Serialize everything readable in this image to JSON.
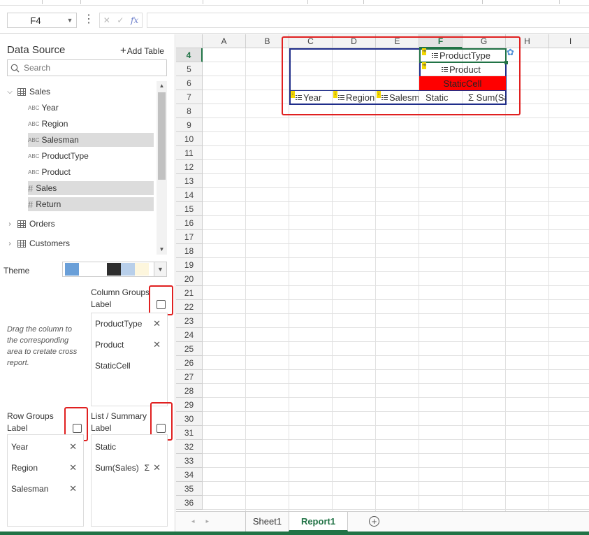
{
  "namebox": {
    "cell": "F4"
  },
  "formula": {
    "fx": "fx",
    "value": ""
  },
  "panel": {
    "title": "Data Source",
    "add_table": "Add Table",
    "search_placeholder": "Search",
    "tree": [
      {
        "label": "Sales",
        "kind": "table",
        "expanded": true
      },
      {
        "label": "Year",
        "kind": "text"
      },
      {
        "label": "Region",
        "kind": "text"
      },
      {
        "label": "Salesman",
        "kind": "text",
        "selected": true
      },
      {
        "label": "ProductType",
        "kind": "text"
      },
      {
        "label": "Product",
        "kind": "text"
      },
      {
        "label": "Sales",
        "kind": "number",
        "selected": true
      },
      {
        "label": "Return",
        "kind": "number",
        "selected": true
      },
      {
        "label": "Orders",
        "kind": "table",
        "expanded": false
      },
      {
        "label": "Customers",
        "kind": "table",
        "expanded": false
      }
    ],
    "theme_label": "Theme",
    "theme_colors": [
      "#6a9fd8",
      "#ffffff",
      "#ffffff",
      "#2e2e2e",
      "#b8cfea",
      "#fdf6dd"
    ],
    "hint": "Drag the column to the corresponding area to cretate cross report.",
    "column_groups": {
      "title": "Column Groups Label",
      "items": [
        "ProductType",
        "Product",
        "StaticCell"
      ]
    },
    "row_groups": {
      "title": "Row Groups Label",
      "items": [
        "Year",
        "Region",
        "Salesman"
      ]
    },
    "list_summary": {
      "title": "List / Summary Label",
      "items": [
        "Static",
        "Sum(Sales)"
      ],
      "sigma": "Σ"
    }
  },
  "sheet": {
    "columns": [
      "A",
      "B",
      "C",
      "D",
      "E",
      "F",
      "G",
      "H",
      "I"
    ],
    "active_column": "F",
    "rows": [
      "4",
      "5",
      "6",
      "7",
      "8",
      "9",
      "10",
      "11",
      "12",
      "13",
      "14",
      "15",
      "16",
      "17",
      "18",
      "19",
      "20",
      "21",
      "22",
      "23",
      "24",
      "25",
      "26",
      "27",
      "28",
      "29",
      "30",
      "31",
      "32",
      "33",
      "34",
      "35",
      "36"
    ],
    "active_row": "4",
    "cells": {
      "F4": "ProductType",
      "F5": "Product",
      "F6": "StaticCell",
      "C7": "Year",
      "D7": "Region",
      "E7": "Salesman",
      "F7": "Static",
      "G7": "Σ Sum(Sales)"
    },
    "highlight_color": "#ff0000"
  },
  "tabs": {
    "items": [
      "Sheet1",
      "Report1"
    ],
    "active": "Report1"
  }
}
